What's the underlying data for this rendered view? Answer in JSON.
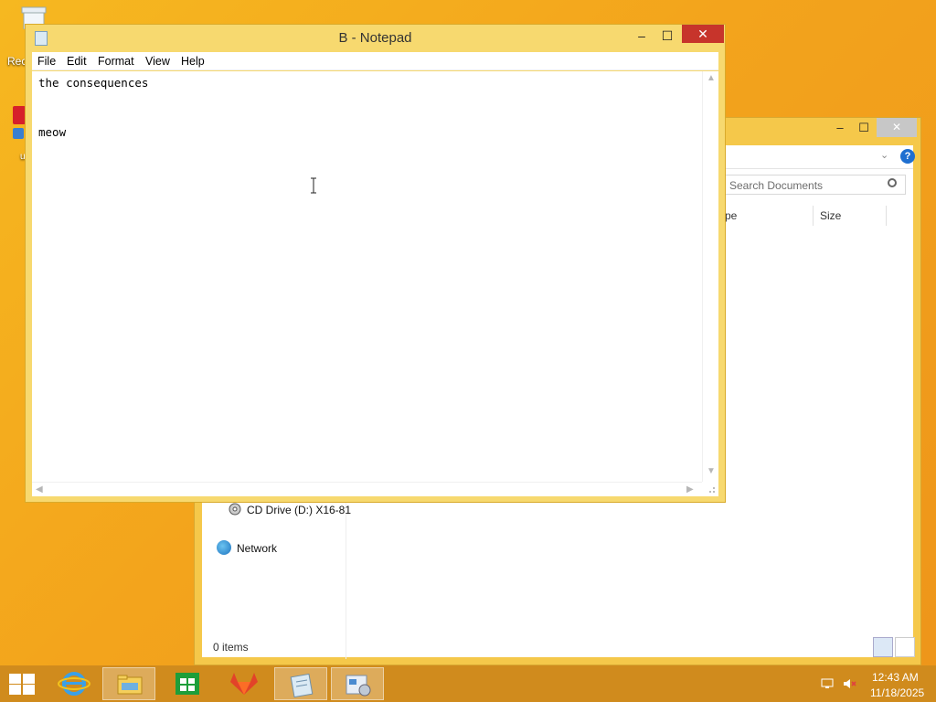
{
  "desktop": {
    "recycle_label": "Rec",
    "icon2_label": "u"
  },
  "notepad": {
    "title": "B - Notepad",
    "menu": [
      "File",
      "Edit",
      "Format",
      "View",
      "Help"
    ],
    "lines": [
      "the consequences",
      "",
      "meow"
    ]
  },
  "explorer": {
    "search_placeholder": "Search Documents",
    "columns": [
      "pe",
      "Size"
    ],
    "nav_items": [
      "CD Drive (D:) X16-81",
      "Network"
    ],
    "status": "0 items"
  },
  "taskbar": {
    "time": "12:43 AM",
    "date": "11/18/2025",
    "apps": [
      "internet-explorer",
      "file-explorer",
      "store",
      "gitlab",
      "notepad",
      "control-panel"
    ]
  },
  "colors": {
    "accent": "#f3a41c",
    "close_red": "#c7342b",
    "taskbar": "#d08b1d"
  }
}
